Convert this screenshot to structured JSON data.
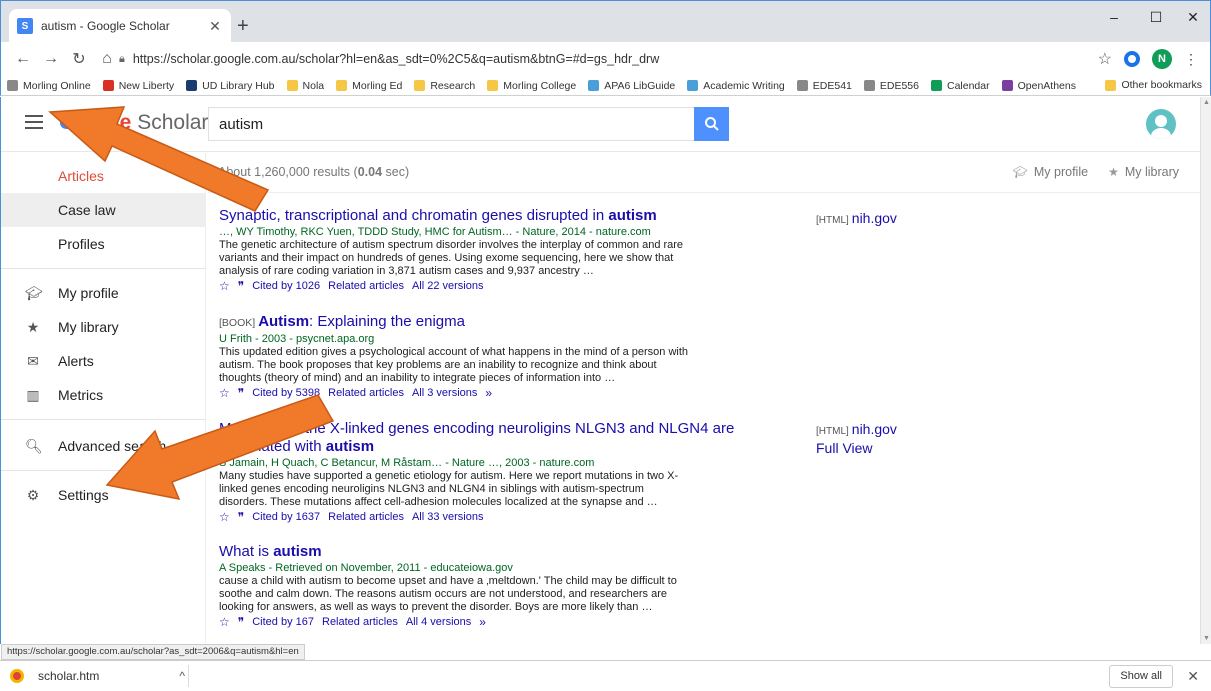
{
  "browser": {
    "tab_title": "autism - Google Scholar",
    "tab_favicon": "S",
    "new_tab": "+",
    "url": "https://scholar.google.com.au/scholar?hl=en&as_sdt=0%2C5&q=autism&btnG=#d=gs_hdr_drw",
    "profile_initial": "N",
    "minimize": "–",
    "maximize": "☐",
    "close": "✕"
  },
  "bookmarks": [
    {
      "label": "Morling Online",
      "color": "#888"
    },
    {
      "label": "New Liberty",
      "color": "#d93025"
    },
    {
      "label": "UD Library Hub",
      "color": "#1a3d6d"
    },
    {
      "label": "Nola",
      "color": "#f6c744"
    },
    {
      "label": "Morling Ed",
      "color": "#f6c744"
    },
    {
      "label": "Research",
      "color": "#f6c744"
    },
    {
      "label": "Morling College",
      "color": "#f6c744"
    },
    {
      "label": "APA6 LibGuide",
      "color": "#4a9fd8"
    },
    {
      "label": "Academic Writing",
      "color": "#4a9fd8"
    },
    {
      "label": "EDE541",
      "color": "#888"
    },
    {
      "label": "EDE556",
      "color": "#888"
    },
    {
      "label": "Calendar",
      "color": "#0f9d58"
    },
    {
      "label": "OpenAthens",
      "color": "#7b3fa0"
    }
  ],
  "other_bookmarks": "Other bookmarks",
  "scholar": {
    "logo_scholar": "Scholar",
    "search_value": "autism",
    "stats_prefix": "About 1,260,000 results (",
    "stats_time": "0.04",
    "stats_suffix": " sec)",
    "my_profile": "My profile",
    "my_library": "My library"
  },
  "sidebar": {
    "articles": "Articles",
    "case_law": "Case law",
    "profiles": "Profiles",
    "my_profile": "My profile",
    "my_library": "My library",
    "alerts": "Alerts",
    "metrics": "Metrics",
    "advanced_search": "Advanced search",
    "settings": "Settings"
  },
  "results": [
    {
      "title_pre": "Synaptic, transcriptional and chromatin genes disrupted in ",
      "title_bold": "autism",
      "meta": "…, WY Timothy, RKC Yuen, TDDD Study, HMC for Autism… - Nature, 2014 - nature.com",
      "snippet": "The genetic architecture of autism spectrum disorder involves the interplay of common and rare variants and their impact on hundreds of genes. Using exome sequencing, here we show that analysis of rare coding variation in 3,871 autism cases and 9,937 ancestry …",
      "cited": "Cited by 1026",
      "related": "Related articles",
      "versions": "All 22 versions",
      "side_tag": "[HTML]",
      "side_source": "nih.gov"
    },
    {
      "tag": "[BOOK]",
      "title_bold": "Autism",
      "title_post": ": Explaining the enigma",
      "meta": "U Frith - 2003 - psycnet.apa.org",
      "snippet": "This updated edition gives a psychological account of what happens in the mind of a person with autism. The book proposes that key problems are an inability to recognize and think about thoughts (theory of mind) and an inability to integrate pieces of information into …",
      "cited": "Cited by 5398",
      "related": "Related articles",
      "versions": "All 3 versions"
    },
    {
      "title_pre": "Mutations of the X-linked genes encoding neuroligins NLGN3 and NLGN4 are associated with ",
      "title_bold": "autism",
      "meta": "S Jamain, H Quach, C Betancur, M Råstam… - Nature …, 2003 - nature.com",
      "snippet": "Many studies have supported a genetic etiology for autism. Here we report mutations in two X-linked genes encoding neuroligins NLGN3 and NLGN4 in siblings with autism-spectrum disorders. These mutations affect cell-adhesion molecules localized at the synapse and …",
      "cited": "Cited by 1637",
      "related": "Related articles",
      "versions": "All 33 versions",
      "side_tag": "[HTML]",
      "side_source": "nih.gov",
      "side_extra": "Full View"
    },
    {
      "title_pre": "What is ",
      "title_bold": "autism",
      "meta": "A Speaks - Retrieved on November, 2011 - educateiowa.gov",
      "snippet": "cause a child with autism to become upset and have a ‚meltdown.' The child may be difficult to soothe and calm down. The reasons autism occurs are not understood, and researchers are looking for answers, as well as ways to prevent the disorder. Boys are more likely than …",
      "cited": "Cited by 167",
      "related": "Related articles",
      "versions": "All 4 versions"
    }
  ],
  "status_url": "https://scholar.google.com.au/scholar?as_sdt=2006&q=autism&hl=en",
  "download": {
    "file": "scholar.htm",
    "show_all": "Show all"
  },
  "colors": {
    "accent_blue": "#4d90fe",
    "link": "#1a0dab",
    "green_meta": "#006621",
    "active_red": "#dd4b39",
    "arrow_orange": "#f07a2a"
  }
}
